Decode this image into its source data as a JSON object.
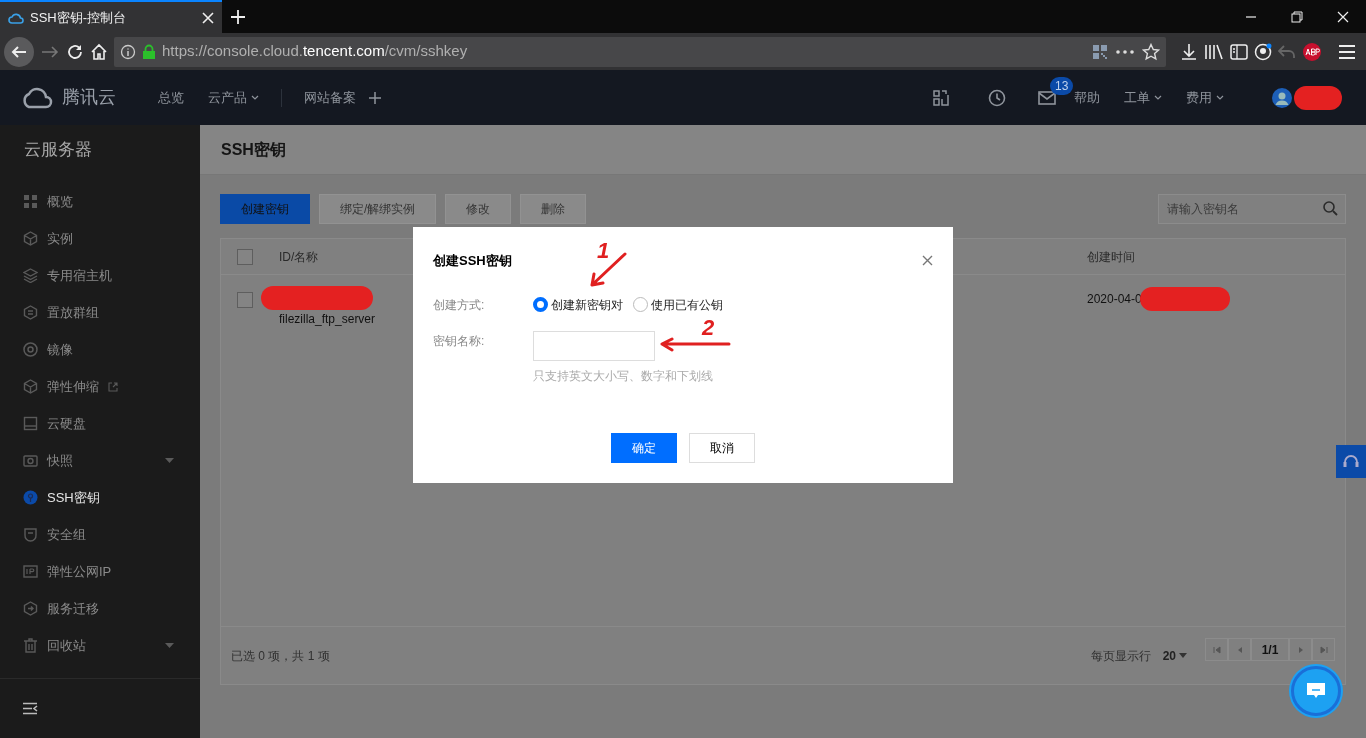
{
  "browser": {
    "tab": {
      "title": "SSH密钥-控制台"
    },
    "url": {
      "prefix": "https://console.cloud.",
      "domain": "tencent.com",
      "path": "/cvm/sshkey"
    }
  },
  "header": {
    "brand": "腾讯云",
    "nav": [
      {
        "label": "总览",
        "dropdown": false
      },
      {
        "label": "云产品",
        "dropdown": true
      },
      {
        "label": "网站备案",
        "dropdown": false
      }
    ],
    "mail_badge": "13",
    "links": [
      {
        "label": "帮助",
        "dropdown": false
      },
      {
        "label": "工单",
        "dropdown": true
      },
      {
        "label": "费用",
        "dropdown": true
      }
    ]
  },
  "sidebar": {
    "title": "云服务器",
    "items": [
      {
        "label": "概览",
        "selected": false,
        "external": false,
        "expandable": false
      },
      {
        "label": "实例",
        "selected": false,
        "external": false,
        "expandable": false
      },
      {
        "label": "专用宿主机",
        "selected": false,
        "external": false,
        "expandable": false
      },
      {
        "label": "置放群组",
        "selected": false,
        "external": false,
        "expandable": false
      },
      {
        "label": "镜像",
        "selected": false,
        "external": false,
        "expandable": false
      },
      {
        "label": "弹性伸缩",
        "selected": false,
        "external": true,
        "expandable": false
      },
      {
        "label": "云硬盘",
        "selected": false,
        "external": false,
        "expandable": false
      },
      {
        "label": "快照",
        "selected": false,
        "external": false,
        "expandable": true
      },
      {
        "label": "SSH密钥",
        "selected": true,
        "external": false,
        "expandable": false
      },
      {
        "label": "安全组",
        "selected": false,
        "external": false,
        "expandable": false
      },
      {
        "label": "弹性公网IP",
        "selected": false,
        "external": false,
        "expandable": false
      },
      {
        "label": "服务迁移",
        "selected": false,
        "external": false,
        "expandable": false
      },
      {
        "label": "回收站",
        "selected": false,
        "external": false,
        "expandable": true
      }
    ]
  },
  "page": {
    "title": "SSH密钥",
    "toolbar": [
      {
        "label": "创建密钥",
        "kind": "primary",
        "disabled": false
      },
      {
        "label": "绑定/解绑实例",
        "kind": "default",
        "disabled": true
      },
      {
        "label": "修改",
        "kind": "default",
        "disabled": true
      },
      {
        "label": "删除",
        "kind": "default",
        "disabled": true
      }
    ],
    "search": {
      "placeholder": "请输入密钥名"
    },
    "table": {
      "header_checked": false,
      "columns": [
        "ID/名称",
        "创建时间"
      ],
      "rows": [
        {
          "checked": false,
          "name": "filezilla_ftp_server",
          "created": "2020-04-0"
        }
      ]
    },
    "footer": {
      "summary": "已选 0 项，共 1 项",
      "page_size_label": "每页显示行",
      "page_size": "20",
      "page": "1/1"
    }
  },
  "dialog": {
    "title": "创建SSH密钥",
    "fields": [
      {
        "kind": "radio",
        "label": "创建方式:",
        "options": [
          {
            "label": "创建新密钥对",
            "selected": true
          },
          {
            "label": "使用已有公钥",
            "selected": false
          }
        ]
      },
      {
        "kind": "text",
        "label": "密钥名称:",
        "hint": "只支持英文大小写、数字和下划线"
      }
    ],
    "buttons": [
      {
        "label": "确定",
        "kind": "primary"
      },
      {
        "label": "取消",
        "kind": "default"
      }
    ]
  },
  "annotations": [
    {
      "label": "1"
    },
    {
      "label": "2"
    }
  ]
}
